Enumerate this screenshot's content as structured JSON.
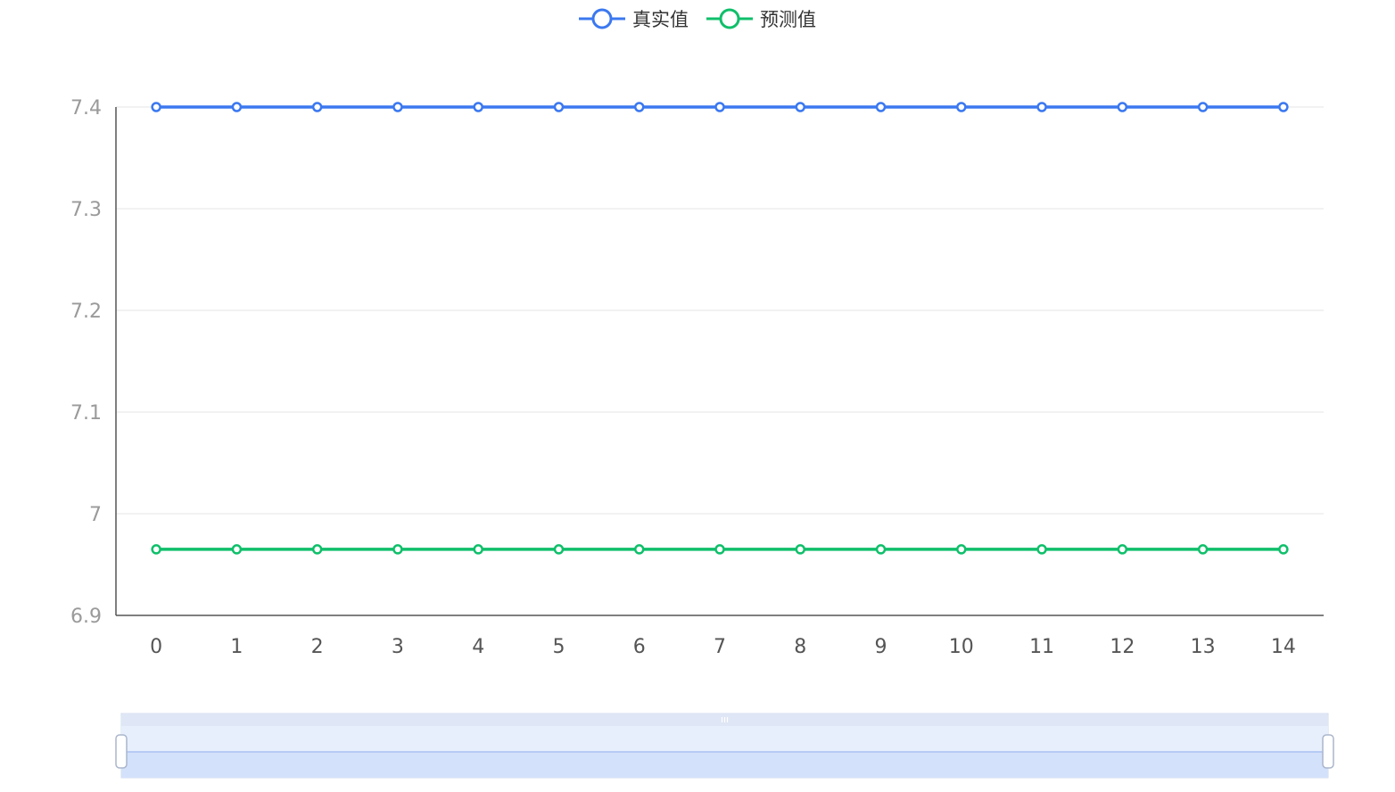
{
  "chart_data": {
    "type": "line",
    "title": "",
    "xlabel": "",
    "ylabel": "",
    "categories": [
      "0",
      "1",
      "2",
      "3",
      "4",
      "5",
      "6",
      "7",
      "8",
      "9",
      "10",
      "11",
      "12",
      "13",
      "14"
    ],
    "yticks": [
      "6.9",
      "7",
      "7.1",
      "7.2",
      "7.3",
      "7.4"
    ],
    "ylim": [
      6.9,
      7.4
    ],
    "grid": true,
    "legend_position": "top-center",
    "series": [
      {
        "name": "真实值",
        "color": "#3b78f0",
        "values": [
          7.4,
          7.4,
          7.4,
          7.4,
          7.4,
          7.4,
          7.4,
          7.4,
          7.4,
          7.4,
          7.4,
          7.4,
          7.4,
          7.4,
          7.4
        ]
      },
      {
        "name": "预测值",
        "color": "#0fbf6a",
        "values": [
          6.965,
          6.965,
          6.965,
          6.965,
          6.965,
          6.965,
          6.965,
          6.965,
          6.965,
          6.965,
          6.965,
          6.965,
          6.965,
          6.965,
          6.965
        ]
      }
    ],
    "data_zoom": {
      "start_percent": 0,
      "end_percent": 100
    }
  }
}
